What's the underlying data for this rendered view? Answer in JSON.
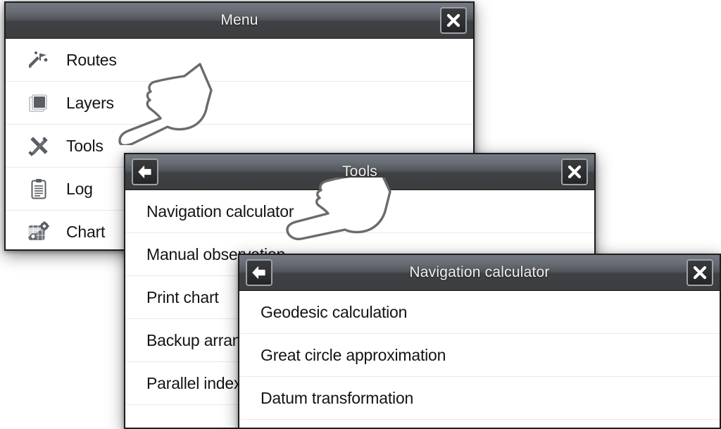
{
  "background_color": "#ffffff",
  "theme": {
    "titlebar_top": "#757a82",
    "titlebar_bottom": "#3c3d3f",
    "panel_border": "#1b1d20",
    "panel_background": "#ffffff",
    "separator": "#f0e6e6",
    "title_text": "#f2f0ec",
    "item_text": "#131417",
    "button_border": "#9da2a8",
    "cursor_stroke": "#6b6b6b"
  },
  "panels": [
    {
      "id": "menu",
      "title": "Menu",
      "has_back_button": false,
      "has_close_button": true,
      "close_icon": "close-icon",
      "items": [
        {
          "label": "Routes",
          "icon": "routes-icon"
        },
        {
          "label": "Layers",
          "icon": "layers-icon"
        },
        {
          "label": "Tools",
          "icon": "tools-icon"
        },
        {
          "label": "Log",
          "icon": "log-icon"
        },
        {
          "label": "Chart",
          "icon": "chart-icon"
        }
      ]
    },
    {
      "id": "tools",
      "title": "Tools",
      "has_back_button": true,
      "has_close_button": true,
      "back_icon": "arrow-left-icon",
      "close_icon": "close-icon",
      "items": [
        {
          "label": "Navigation calculator",
          "icon": null
        },
        {
          "label": "Manual observation",
          "icon": null
        },
        {
          "label": "Print chart",
          "icon": null
        },
        {
          "label": "Backup arrangement",
          "icon": null
        },
        {
          "label": "Parallel index",
          "icon": null
        }
      ]
    },
    {
      "id": "navcalc",
      "title": "Navigation calculator",
      "has_back_button": true,
      "has_close_button": true,
      "back_icon": "arrow-left-icon",
      "close_icon": "close-icon",
      "items": [
        {
          "label": "Geodesic calculation",
          "icon": null
        },
        {
          "label": "Great circle approximation",
          "icon": null
        },
        {
          "label": "Datum transformation",
          "icon": null
        }
      ]
    }
  ],
  "cursors": [
    {
      "id": "hand-tools",
      "icon": "pointing-hand-cursor",
      "points_at": "Tools"
    },
    {
      "id": "hand-navcalc",
      "icon": "pointing-hand-cursor",
      "points_at": "Navigation calculator"
    }
  ]
}
